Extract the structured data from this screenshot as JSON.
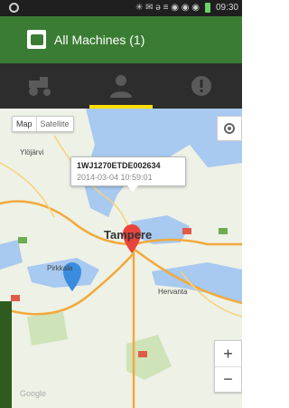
{
  "status_bar": {
    "time": "09:30",
    "signal": "✳ ✉ ə ≡ ◉ ◉ ◉"
  },
  "action_bar": {
    "title": "All Machines (1)"
  },
  "tabs": [
    {
      "name": "machines",
      "icon": "tractor-icon",
      "active": false
    },
    {
      "name": "operators",
      "icon": "person-icon",
      "active": true
    },
    {
      "name": "alerts",
      "icon": "alert-icon",
      "active": false
    }
  ],
  "map": {
    "type_buttons": [
      "Map",
      "Satellite"
    ],
    "places": [
      "Ylöjärvi",
      "Tampere",
      "Pirkkala",
      "Hervanta"
    ],
    "info_window": {
      "machine_id": "1WJ1270ETDE002634",
      "timestamp": "2014-03-04 10:59:01"
    },
    "zoom_in": "+",
    "zoom_out": "−",
    "attribution": "Google"
  },
  "colors": {
    "action_bar": "#3a7c33",
    "tab_bar": "#2d2d2d",
    "tab_indicator": "#ffde00",
    "marker_red": "#e8443c",
    "marker_blue": "#3a8dde"
  }
}
